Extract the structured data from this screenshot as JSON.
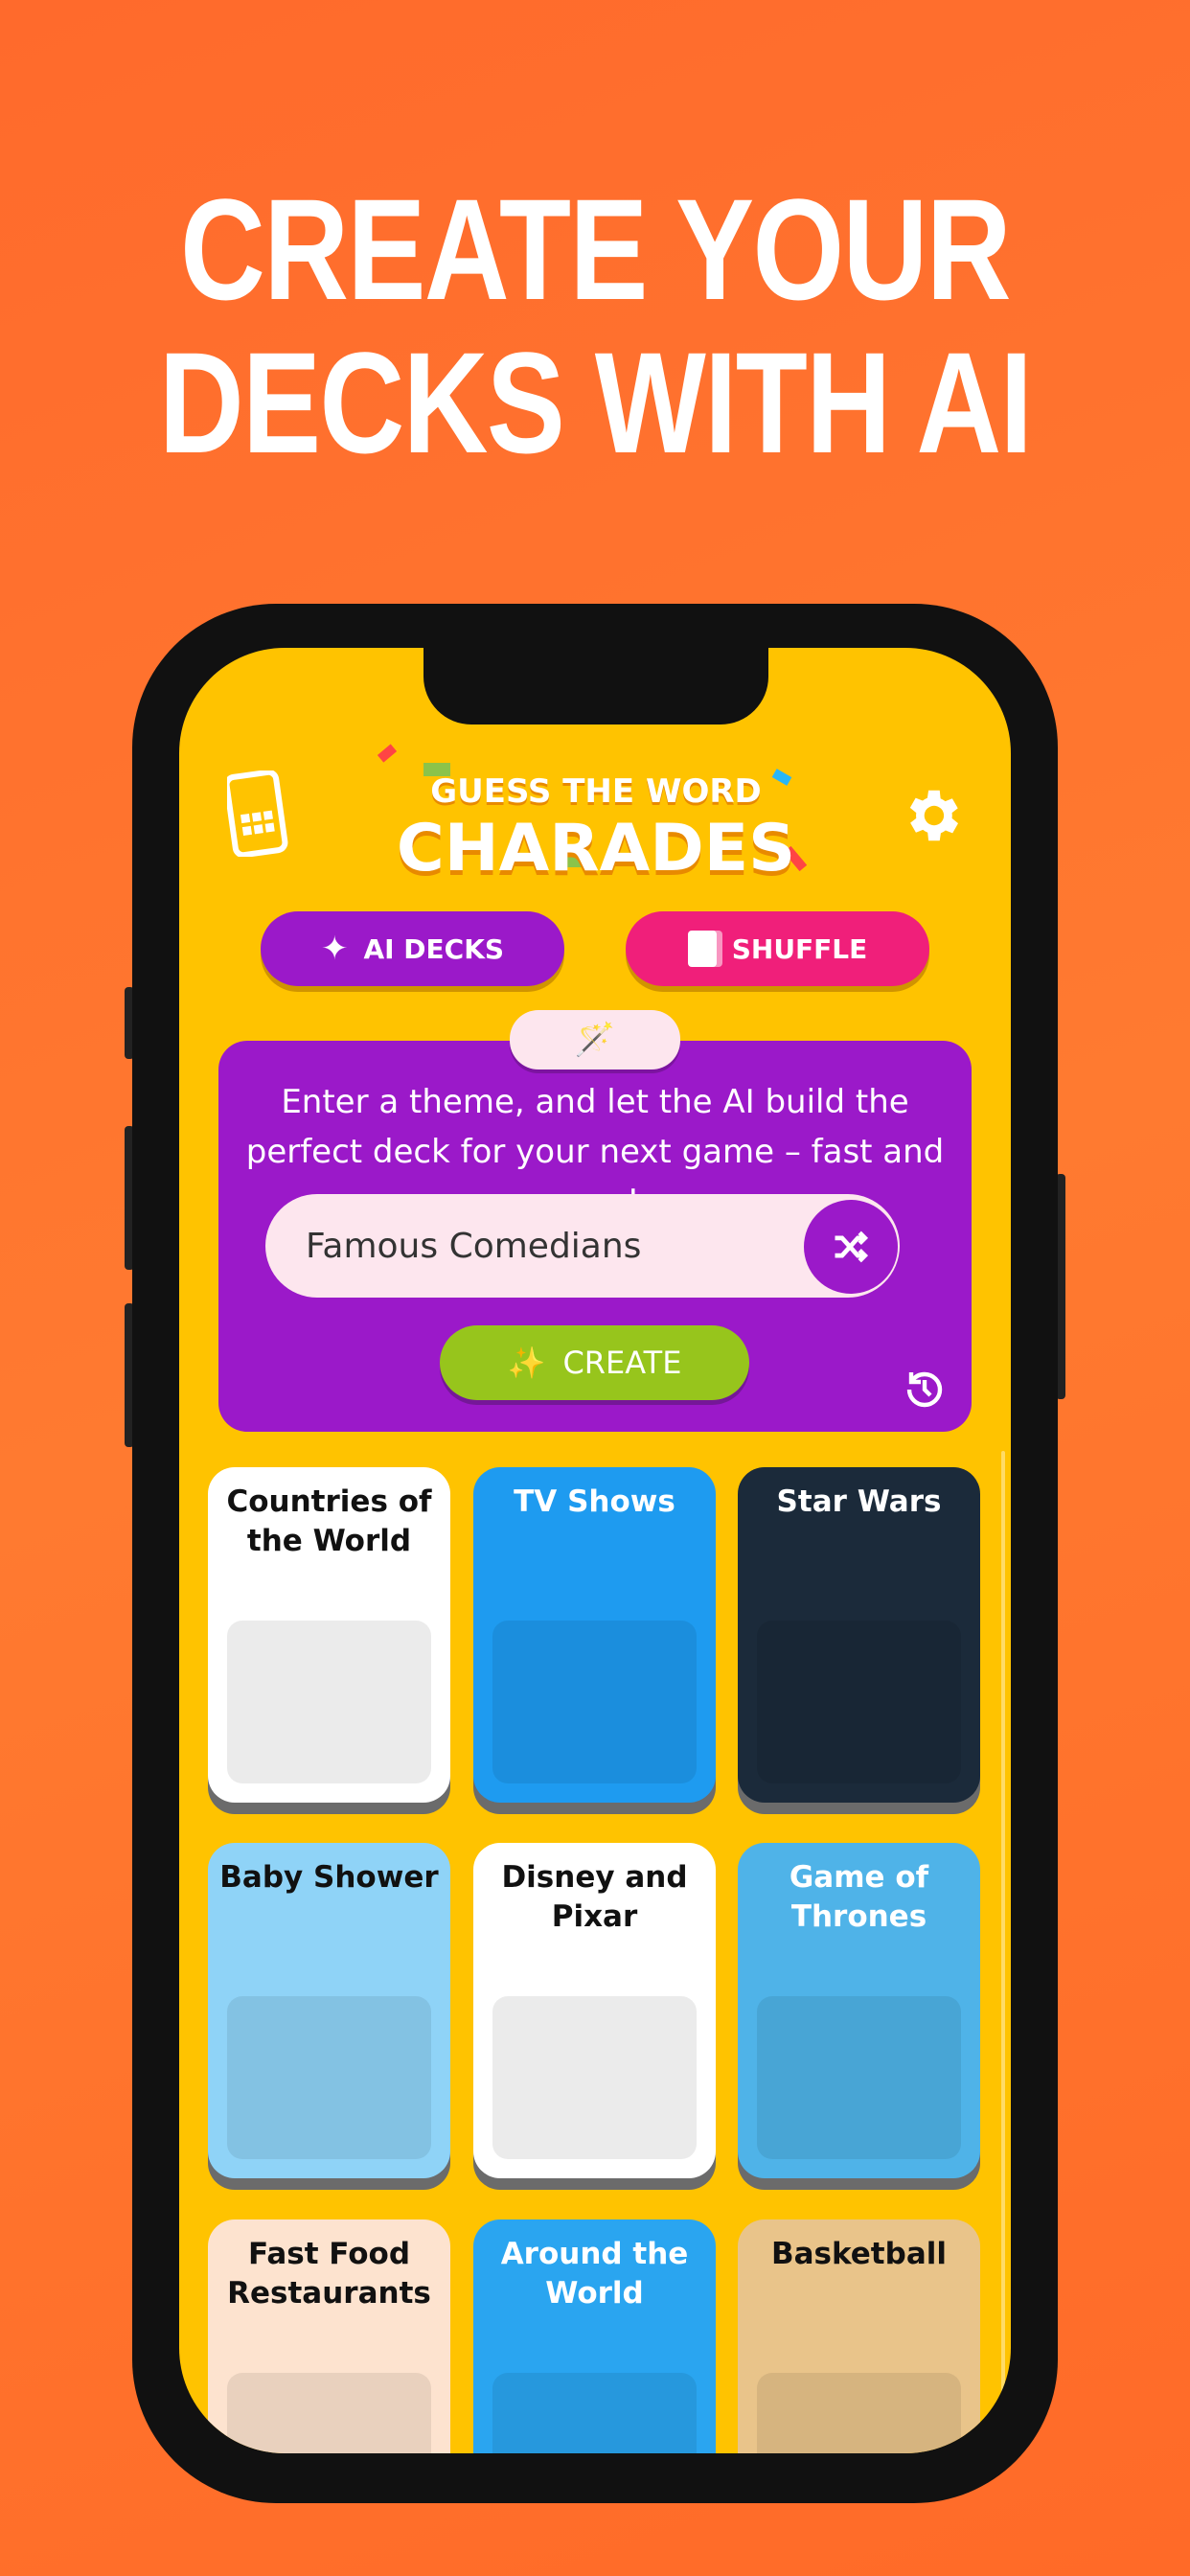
{
  "headline": {
    "line1": "CREATE YOUR",
    "line2": "DECKS WITH AI"
  },
  "app": {
    "logo": {
      "line1": "GUESS THE WORD",
      "line2": "CHARADES"
    },
    "header_icons": {
      "left": "phone-grid-icon",
      "right": "gear-icon"
    },
    "buttons": {
      "ai_decks": "AI DECKS",
      "shuffle": "SHUFFLE"
    },
    "ai_panel": {
      "description": "Enter a theme, and let the AI build the perfect deck for your next game – fast and easy!",
      "input_value": "Famous Comedians",
      "create_label": "CREATE"
    },
    "decks": [
      {
        "title": "Countries of the World",
        "bg": "#ffffff",
        "color": "#111111"
      },
      {
        "title": "TV Shows",
        "bg": "#1e9bf0",
        "color": "#ffffff"
      },
      {
        "title": "Star Wars",
        "bg": "#1b2a3a",
        "color": "#ffffff"
      },
      {
        "title": "Baby Shower",
        "bg": "#8fd3f7",
        "color": "#111111"
      },
      {
        "title": "Disney and Pixar",
        "bg": "#ffffff",
        "color": "#111111"
      },
      {
        "title": "Game of Thrones",
        "bg": "#4fb3e8",
        "color": "#ffffff"
      },
      {
        "title": "Fast Food Restaurants",
        "bg": "#fde3cf",
        "color": "#111111"
      },
      {
        "title": "Around the World",
        "bg": "#2aa5f0",
        "color": "#ffffff"
      },
      {
        "title": "Basketball",
        "bg": "#e9c48a",
        "color": "#111111"
      }
    ],
    "colors": {
      "background": "#ffc300",
      "purple": "#9b19c9",
      "pink": "#f01f7a",
      "green": "#97c51c",
      "orange": "#ff6a2c"
    }
  }
}
